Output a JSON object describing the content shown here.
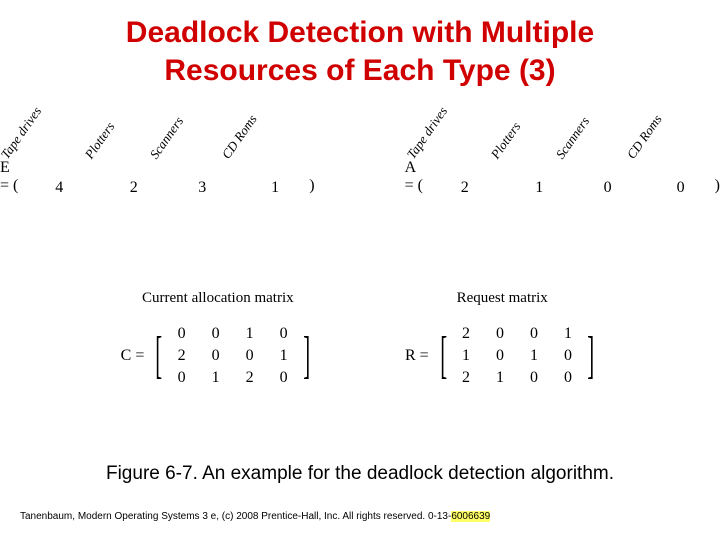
{
  "title_line1": "Deadlock Detection with Multiple",
  "title_line2": "Resources of Each Type (3)",
  "resource_labels": [
    "Tape drives",
    "Plotters",
    "Scanners",
    "CD Roms"
  ],
  "vectors": {
    "E": {
      "label": "E = (",
      "values": [
        "4",
        "2",
        "3",
        "1"
      ],
      "close": ")"
    },
    "A": {
      "label": "A = (",
      "values": [
        "2",
        "1",
        "0",
        "0"
      ],
      "close": ")"
    }
  },
  "matrices": {
    "C": {
      "title": "Current allocation matrix",
      "label": "C =",
      "rows": [
        [
          "0",
          "0",
          "1",
          "0"
        ],
        [
          "2",
          "0",
          "0",
          "1"
        ],
        [
          "0",
          "1",
          "2",
          "0"
        ]
      ]
    },
    "R": {
      "title": "Request matrix",
      "label": "R =",
      "rows": [
        [
          "2",
          "0",
          "0",
          "1"
        ],
        [
          "1",
          "0",
          "1",
          "0"
        ],
        [
          "2",
          "1",
          "0",
          "0"
        ]
      ]
    }
  },
  "caption": "Figure 6-7. An example for the deadlock detection algorithm.",
  "footer_prefix": "Tanenbaum, Modern Operating Systems 3 e, (c) 2008 Prentice-Hall, Inc. All rights reserved. 0-13-",
  "footer_isbn_tail": "6006639"
}
